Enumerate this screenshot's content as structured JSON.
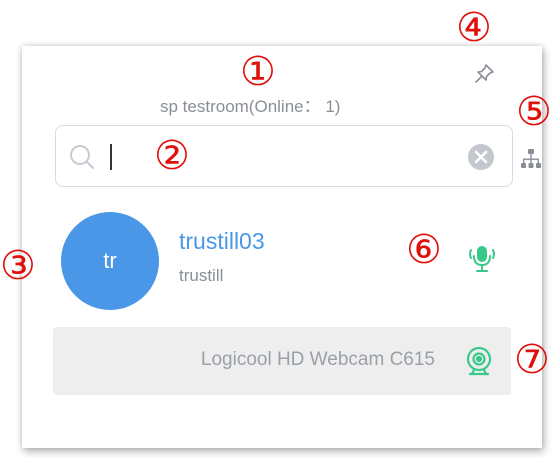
{
  "room": {
    "title": "sp testroom(Online： 1)"
  },
  "search": {
    "value": "",
    "placeholder": ""
  },
  "participant": {
    "initials": "tr",
    "name": "trustill03",
    "subtitle": "trustill"
  },
  "camera": {
    "label": "Logicool HD Webcam C615"
  },
  "markers": [
    "①",
    "②",
    "③",
    "④",
    "⑤",
    "⑥",
    "⑦"
  ],
  "icons": {
    "pin": "pin-icon",
    "org": "org-chart-icon",
    "search": "search-icon",
    "clear": "clear-icon",
    "mic": "microphone-icon",
    "camera": "webcam-icon"
  },
  "colors": {
    "accent": "#4a97e8",
    "active_green": "#38c98a",
    "marker_red": "#e0100a",
    "muted_text": "#8a8f97"
  }
}
